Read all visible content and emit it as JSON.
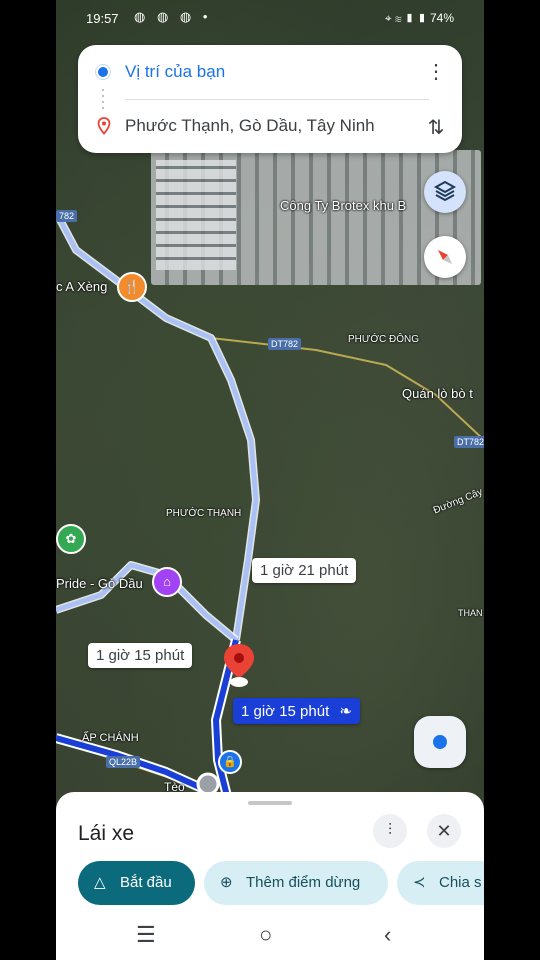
{
  "status_bar": {
    "time": "19:57",
    "battery": "74%",
    "left_icons": "◍ ◍ ◍ •",
    "right_icons": "⌖ ≋ ▮ ▮"
  },
  "search": {
    "origin": "Vị trí của bạn",
    "destination": "Phước Thạnh, Gò Dầu, Tây Ninh"
  },
  "map_labels": {
    "company": "Công Ty Brotex khu B",
    "a_xeng": "c A Xèng",
    "phuoc_dong": "PHƯỚC ĐÔNG",
    "quan_lo": "Quán lò bò t",
    "phuoc_thanh": "PHƯỚC THẠNH",
    "duong_cay": "Đường Cây",
    "pride": "Pride - Gò Dầu",
    "ap_chanh": "ẤP CHÁNH",
    "teo": "Tèo",
    "than": "THAN"
  },
  "road_tags": {
    "dt782_a": "782",
    "dt782_b": "DT782",
    "dt782_c": "DT782",
    "ql22b": "QL22B"
  },
  "route_bubbles": {
    "alt1": "1 giờ 21 phút",
    "alt2": "1 giờ 15 phút",
    "main": "1 giờ 15 phút"
  },
  "bottom_sheet": {
    "mode": "Lái xe",
    "start_label": "Bắt đầu",
    "add_stop_label": "Thêm điểm dừng",
    "share_label": "Chia s"
  },
  "colors": {
    "route_main": "#1a3fd6",
    "route_alt": "#a9c1f5",
    "accent": "#1a73e8",
    "start_button": "#0b6b7d"
  }
}
